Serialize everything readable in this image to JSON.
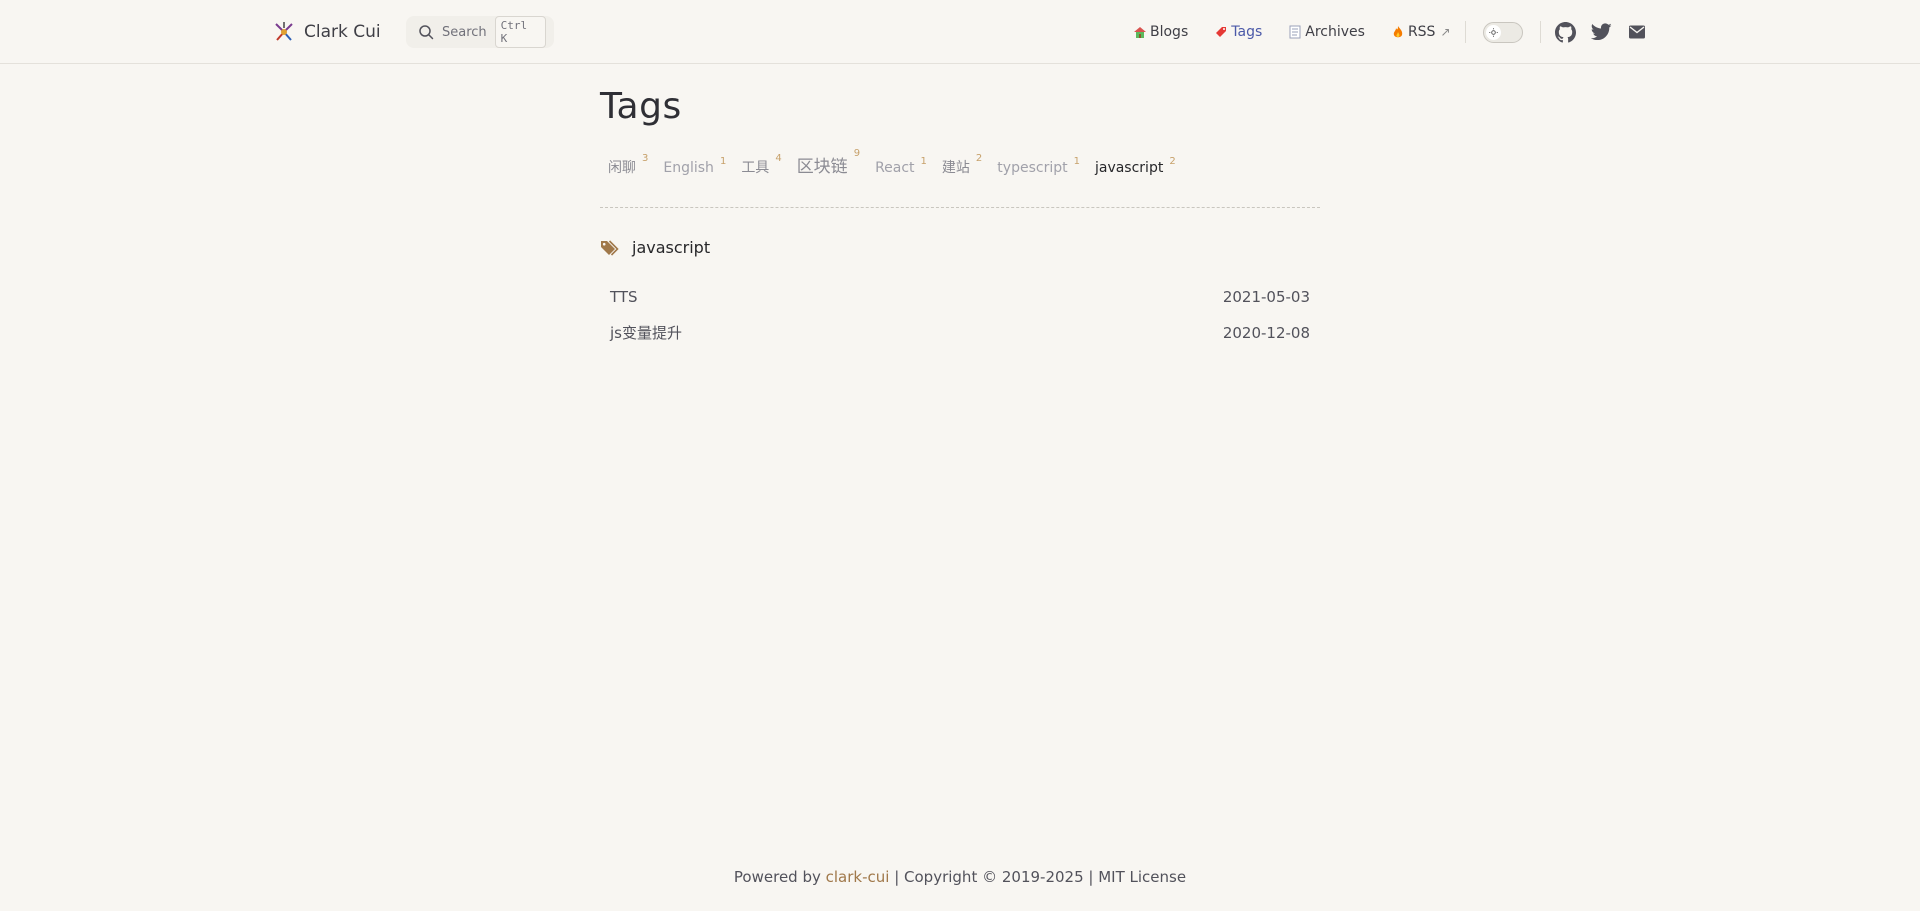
{
  "header": {
    "brand": "Clark Cui",
    "search": {
      "placeholder": "Search",
      "shortcut": "Ctrl K"
    },
    "nav": [
      {
        "label": "Blogs",
        "icon": "house-emoji-icon"
      },
      {
        "label": "Tags",
        "icon": "bookmark-emoji-icon",
        "active": true
      },
      {
        "label": "Archives",
        "icon": "notepad-emoji-icon"
      },
      {
        "label": "RSS",
        "icon": "fire-emoji-icon",
        "external": "↗"
      }
    ],
    "social": [
      "github-icon",
      "twitter-icon",
      "mail-icon"
    ]
  },
  "page": {
    "title": "Tags"
  },
  "tags": [
    {
      "name": "闲聊",
      "count": "3"
    },
    {
      "name": "English",
      "count": "1"
    },
    {
      "name": "工具",
      "count": "4"
    },
    {
      "name": "区块链",
      "count": "9"
    },
    {
      "name": "React",
      "count": "1"
    },
    {
      "name": "建站",
      "count": "2"
    },
    {
      "name": "typescript",
      "count": "1"
    },
    {
      "name": "javascript",
      "count": "2"
    }
  ],
  "section": {
    "title": "javascript"
  },
  "posts": [
    {
      "title": "TTS",
      "date": "2021-05-03"
    },
    {
      "title": "js变量提升",
      "date": "2020-12-08"
    }
  ],
  "footer": {
    "prefix": "Powered by ",
    "link": "clark-cui",
    "suffix": " | Copyright © 2019-2025 | MIT License"
  },
  "colors": {
    "accent": "#4b59a8",
    "tag_count": "#c7a16b",
    "footer_link": "#a0784a",
    "background": "#f8f6f2"
  }
}
